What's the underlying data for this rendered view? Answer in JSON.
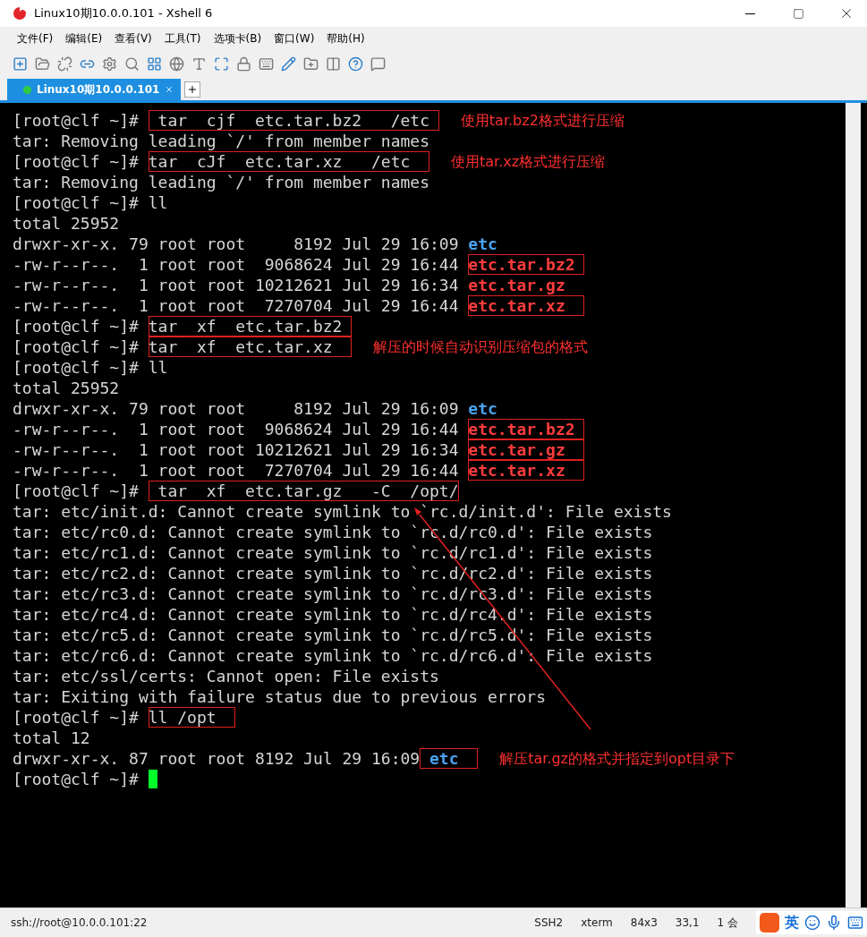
{
  "window": {
    "title": "Linux10期10.0.0.101 - Xshell 6"
  },
  "menu": [
    "文件(F)",
    "编辑(E)",
    "查看(V)",
    "工具(T)",
    "选项卡(B)",
    "窗口(W)",
    "帮助(H)"
  ],
  "tabs": [
    {
      "label": "Linux10期10.0.0.101",
      "selected": true,
      "connected": true
    }
  ],
  "terminal": {
    "lines": [
      {
        "segments": [
          {
            "text": "[root@clf ~]# ",
            "kind": "plain"
          },
          {
            "text": " tar  cjf  etc.tar.bz2   /etc ",
            "kind": "plain",
            "boxed": true
          }
        ],
        "note": "使用tar.bz2格式进行压缩"
      },
      {
        "segments": [
          {
            "text": "tar: Removing leading `/' from member names",
            "kind": "plain"
          }
        ]
      },
      {
        "segments": [
          {
            "text": "[root@clf ~]# ",
            "kind": "plain"
          },
          {
            "text": "tar  cJf  etc.tar.xz   /etc  ",
            "kind": "plain",
            "boxed": true
          }
        ],
        "note": "使用tar.xz格式进行压缩"
      },
      {
        "segments": [
          {
            "text": "tar: Removing leading `/' from member names",
            "kind": "plain"
          }
        ]
      },
      {
        "segments": [
          {
            "text": "[root@clf ~]# ll",
            "kind": "plain"
          }
        ]
      },
      {
        "segments": [
          {
            "text": "total 25952",
            "kind": "plain"
          }
        ]
      },
      {
        "segments": [
          {
            "text": "drwxr-xr-x. 79 root root     8192 Jul 29 16:09 ",
            "kind": "plain"
          },
          {
            "text": "etc",
            "kind": "dir"
          }
        ]
      },
      {
        "segments": [
          {
            "text": "-rw-r--r--.  1 root root  9068624 Jul 29 16:44 ",
            "kind": "plain"
          },
          {
            "text": "etc.tar.bz2 ",
            "kind": "archive",
            "boxed": true
          }
        ]
      },
      {
        "segments": [
          {
            "text": "-rw-r--r--.  1 root root 10212621 Jul 29 16:34 ",
            "kind": "plain"
          },
          {
            "text": "etc.tar.gz",
            "kind": "archive"
          }
        ]
      },
      {
        "segments": [
          {
            "text": "-rw-r--r--.  1 root root  7270704 Jul 29 16:44 ",
            "kind": "plain"
          },
          {
            "text": "etc.tar.xz  ",
            "kind": "archive",
            "boxed": true
          }
        ]
      },
      {
        "segments": [
          {
            "text": "[root@clf ~]# ",
            "kind": "plain"
          },
          {
            "text": "tar  xf  etc.tar.bz2 ",
            "kind": "plain",
            "boxed": true
          }
        ]
      },
      {
        "segments": [
          {
            "text": "[root@clf ~]# ",
            "kind": "plain"
          },
          {
            "text": "tar  xf  etc.tar.xz  ",
            "kind": "plain",
            "boxed": true
          }
        ],
        "note": "解压的时候自动识别压缩包的格式"
      },
      {
        "segments": [
          {
            "text": "[root@clf ~]# ll",
            "kind": "plain"
          }
        ]
      },
      {
        "segments": [
          {
            "text": "total 25952",
            "kind": "plain"
          }
        ]
      },
      {
        "segments": [
          {
            "text": "drwxr-xr-x. 79 root root     8192 Jul 29 16:09 ",
            "kind": "plain"
          },
          {
            "text": "etc",
            "kind": "dir"
          }
        ]
      },
      {
        "segments": [
          {
            "text": "-rw-r--r--.  1 root root  9068624 Jul 29 16:44 ",
            "kind": "plain"
          },
          {
            "text": "etc.tar.bz2 ",
            "kind": "archive",
            "boxed": true
          }
        ]
      },
      {
        "segments": [
          {
            "text": "-rw-r--r--.  1 root root 10212621 Jul 29 16:34 ",
            "kind": "plain"
          },
          {
            "text": "etc.tar.gz  ",
            "kind": "archive",
            "boxed": true
          }
        ]
      },
      {
        "segments": [
          {
            "text": "-rw-r--r--.  1 root root  7270704 Jul 29 16:44 ",
            "kind": "plain"
          },
          {
            "text": "etc.tar.xz  ",
            "kind": "archive",
            "boxed": true
          }
        ]
      },
      {
        "segments": [
          {
            "text": "[root@clf ~]# ",
            "kind": "plain"
          },
          {
            "text": " tar  xf  etc.tar.gz   -C  /opt/",
            "kind": "plain",
            "boxed": true
          }
        ]
      },
      {
        "segments": [
          {
            "text": "tar: etc/init.d: Cannot create symlink to `rc.d/init.d': File exists",
            "kind": "plain"
          }
        ]
      },
      {
        "segments": [
          {
            "text": "tar: etc/rc0.d: Cannot create symlink to `rc.d/rc0.d': File exists",
            "kind": "plain"
          }
        ]
      },
      {
        "segments": [
          {
            "text": "tar: etc/rc1.d: Cannot create symlink to `rc.d/rc1.d': File exists",
            "kind": "plain"
          }
        ]
      },
      {
        "segments": [
          {
            "text": "tar: etc/rc2.d: Cannot create symlink to `rc.d/rc2.d': File exists",
            "kind": "plain"
          }
        ]
      },
      {
        "segments": [
          {
            "text": "tar: etc/rc3.d: Cannot create symlink to `rc.d/rc3.d': File exists",
            "kind": "plain"
          }
        ]
      },
      {
        "segments": [
          {
            "text": "tar: etc/rc4.d: Cannot create symlink to `rc.d/rc4.d': File exists",
            "kind": "plain"
          }
        ]
      },
      {
        "segments": [
          {
            "text": "tar: etc/rc5.d: Cannot create symlink to `rc.d/rc5.d': File exists",
            "kind": "plain"
          }
        ]
      },
      {
        "segments": [
          {
            "text": "tar: etc/rc6.d: Cannot create symlink to `rc.d/rc6.d': File exists",
            "kind": "plain"
          }
        ]
      },
      {
        "segments": [
          {
            "text": "tar: etc/ssl/certs: Cannot open: File exists",
            "kind": "plain"
          }
        ]
      },
      {
        "segments": [
          {
            "text": "tar: Exiting with failure status due to previous errors",
            "kind": "plain"
          }
        ]
      },
      {
        "segments": [
          {
            "text": "[root@clf ~]# ",
            "kind": "plain"
          },
          {
            "text": "ll /opt  ",
            "kind": "plain",
            "boxed": true
          }
        ]
      },
      {
        "segments": [
          {
            "text": "total 12",
            "kind": "plain"
          }
        ]
      },
      {
        "segments": [
          {
            "text": "drwxr-xr-x. 87 root root 8192 Jul 29 16:09",
            "kind": "plain"
          },
          {
            "text": " etc  ",
            "kind": "dir",
            "boxed": true
          }
        ],
        "note": "解压tar.gz的格式并指定到opt目录下"
      },
      {
        "segments": [
          {
            "text": "[root@clf ~]# ",
            "kind": "plain"
          }
        ],
        "cursor": true
      }
    ]
  },
  "status_bar": {
    "address": "ssh://root@10.0.0.101:22",
    "items": [
      "SSH2",
      "xterm",
      "84x3",
      "33,1",
      "1 会"
    ]
  },
  "ime": {
    "mode": "英"
  }
}
